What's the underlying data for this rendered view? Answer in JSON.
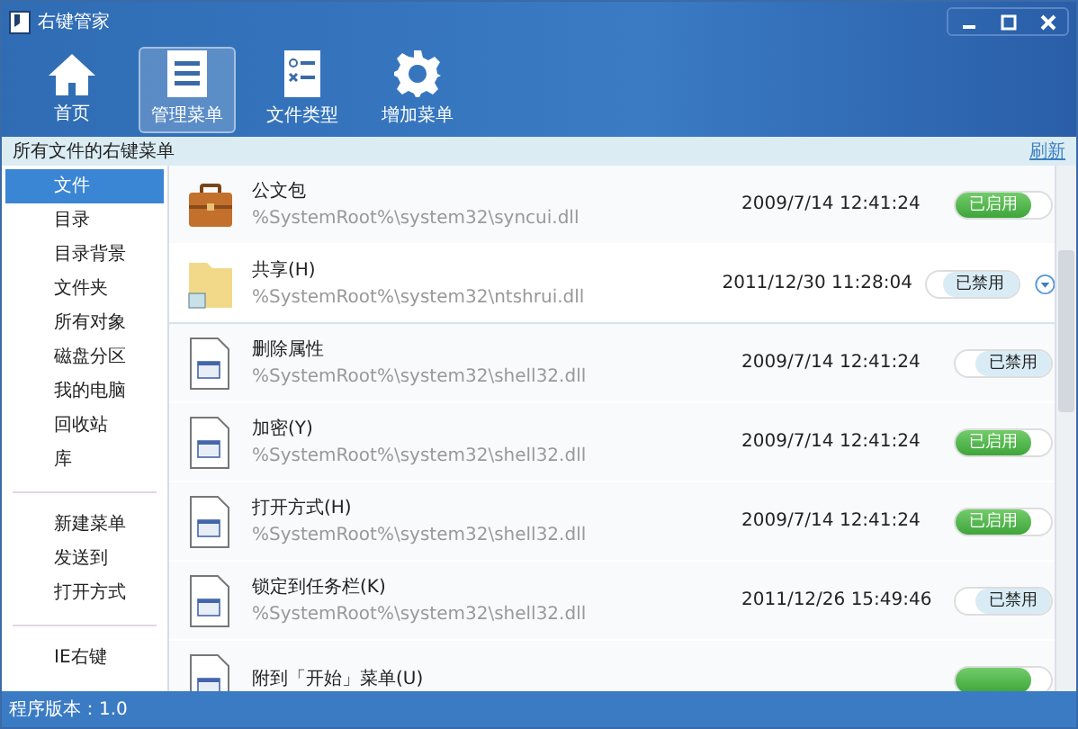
{
  "window": {
    "title": "右键管家"
  },
  "toolbar": [
    {
      "label": "首页",
      "kind": "home",
      "selected": false
    },
    {
      "label": "管理菜单",
      "kind": "menu",
      "selected": true
    },
    {
      "label": "文件类型",
      "kind": "types",
      "selected": false
    },
    {
      "label": "增加菜单",
      "kind": "add",
      "selected": false
    }
  ],
  "header": {
    "title": "所有文件的右键菜单",
    "refresh": "刷新"
  },
  "sidebar": {
    "groups": [
      [
        {
          "label": "文件",
          "selected": true
        },
        {
          "label": "目录",
          "selected": false
        },
        {
          "label": "目录背景",
          "selected": false
        },
        {
          "label": "文件夹",
          "selected": false
        },
        {
          "label": "所有对象",
          "selected": false
        },
        {
          "label": "磁盘分区",
          "selected": false
        },
        {
          "label": "我的电脑",
          "selected": false
        },
        {
          "label": "回收站",
          "selected": false
        },
        {
          "label": "库",
          "selected": false
        }
      ],
      [
        {
          "label": "新建菜单",
          "selected": false
        },
        {
          "label": "发送到",
          "selected": false
        },
        {
          "label": "打开方式",
          "selected": false
        }
      ],
      [
        {
          "label": "IE右键",
          "selected": false
        }
      ]
    ]
  },
  "items": [
    {
      "name": "公文包",
      "path": "%SystemRoot%\\system32\\syncui.dll",
      "date": "2009/7/14 12:41:24",
      "kind": "briefcase",
      "enabled": true,
      "switch_label": "已启用",
      "hovered": false
    },
    {
      "name": "共享(H)",
      "path": "%SystemRoot%\\system32\\ntshrui.dll",
      "date": "2011/12/30 11:28:04",
      "kind": "folder",
      "enabled": false,
      "switch_label": "已禁用",
      "hovered": true
    },
    {
      "name": "删除属性",
      "path": "%SystemRoot%\\system32\\shell32.dll",
      "date": "2009/7/14 12:41:24",
      "kind": "file",
      "enabled": false,
      "switch_label": "已禁用",
      "hovered": false
    },
    {
      "name": "加密(Y)",
      "path": "%SystemRoot%\\system32\\shell32.dll",
      "date": "2009/7/14 12:41:24",
      "kind": "file",
      "enabled": true,
      "switch_label": "已启用",
      "hovered": false
    },
    {
      "name": "打开方式(H)",
      "path": "%SystemRoot%\\system32\\shell32.dll",
      "date": "2009/7/14 12:41:24",
      "kind": "file",
      "enabled": true,
      "switch_label": "已启用",
      "hovered": false
    },
    {
      "name": "锁定到任务栏(K)",
      "path": "%SystemRoot%\\system32\\shell32.dll",
      "date": "2011/12/26 15:49:46",
      "kind": "file",
      "enabled": false,
      "switch_label": "已禁用",
      "hovered": false
    },
    {
      "name": "附到「开始」菜单(U)",
      "kind": "file",
      "enabled": true,
      "hovered": false
    }
  ],
  "status_bar": {
    "text": "程序版本：1.0"
  }
}
